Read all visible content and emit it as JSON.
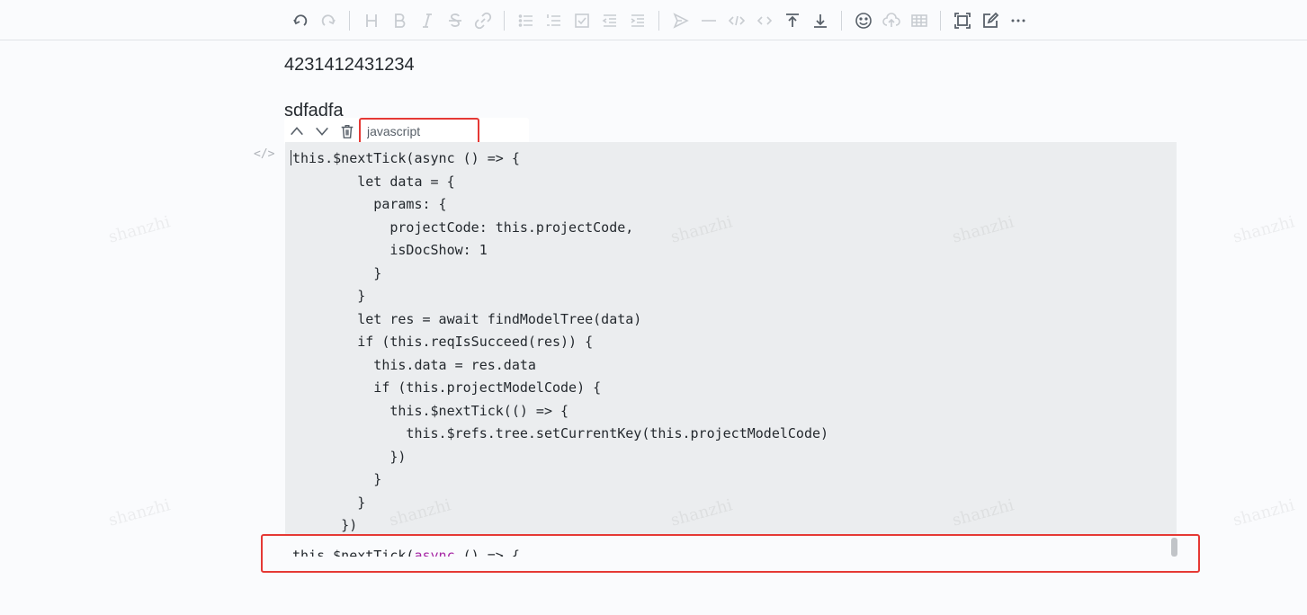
{
  "toolbar": {
    "buttons": [
      {
        "name": "undo-icon",
        "glyph": "undo",
        "disabled": false
      },
      {
        "name": "redo-icon",
        "glyph": "redo",
        "disabled": true
      },
      {
        "name": "headings-icon",
        "glyph": "H"
      },
      {
        "name": "bold-icon",
        "glyph": "B"
      },
      {
        "name": "italic-icon",
        "glyph": "I"
      },
      {
        "name": "strike-icon",
        "glyph": "S"
      },
      {
        "name": "link-icon",
        "glyph": "link"
      },
      {
        "name": "list-icon",
        "glyph": "list"
      },
      {
        "name": "ordered-list-icon",
        "glyph": "olist"
      },
      {
        "name": "check-icon",
        "glyph": "check"
      },
      {
        "name": "outdent-icon",
        "glyph": "outdent"
      },
      {
        "name": "indent-icon",
        "glyph": "indent"
      },
      {
        "name": "quote-icon",
        "glyph": "quote"
      },
      {
        "name": "line-icon",
        "glyph": "line"
      },
      {
        "name": "code-icon",
        "glyph": "code"
      },
      {
        "name": "inline-code-icon",
        "glyph": "inline-code"
      },
      {
        "name": "insert-before-icon",
        "glyph": "insert-before"
      },
      {
        "name": "insert-after-icon",
        "glyph": "insert-after"
      },
      {
        "name": "emoji-icon",
        "glyph": "emoji"
      },
      {
        "name": "upload-icon",
        "glyph": "upload"
      },
      {
        "name": "table-icon",
        "glyph": "table"
      },
      {
        "name": "fullscreen-icon",
        "glyph": "fullscreen"
      },
      {
        "name": "edit-mode-icon",
        "glyph": "edit"
      },
      {
        "name": "more-icon",
        "glyph": "more"
      }
    ]
  },
  "content": {
    "paragraph_1": "4231412431234",
    "paragraph_2": "sdfadfa"
  },
  "code_block": {
    "language": "javascript",
    "marker": "</>",
    "code": "this.$nextTick(async () => {\n        let data = {\n          params: {\n            projectCode: this.projectCode,\n            isDocShow: 1\n          }\n        }\n        let res = await findModelTree(data)\n        if (this.reqIsSucceed(res)) {\n          this.data = res.data\n          if (this.projectModelCode) {\n            this.$nextTick(() => {\n              this.$refs.tree.setCurrentKey(this.projectModelCode)\n            })\n          }\n        }\n      })",
    "preview_line_start": "this.$nextTick(",
    "preview_line_kw": "async",
    "preview_line_end": " () => {"
  },
  "watermark": "shanzhi",
  "colors": {
    "highlight_border": "#e53935",
    "code_background": "#ebedef",
    "keyword": "#a626a4"
  }
}
